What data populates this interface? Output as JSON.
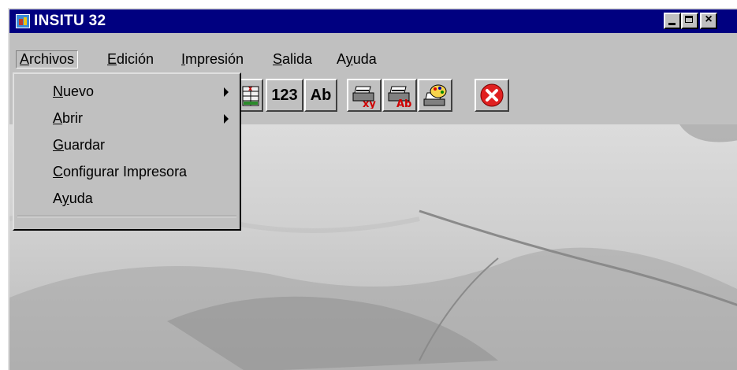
{
  "window": {
    "title": "INSITU 32"
  },
  "menubar": {
    "items": [
      {
        "label_pre": "",
        "label_u": "A",
        "label_post": "rchivos"
      },
      {
        "label_pre": "",
        "label_u": "E",
        "label_post": "dición"
      },
      {
        "label_pre": "",
        "label_u": "I",
        "label_post": "mpresión"
      },
      {
        "label_pre": "",
        "label_u": "S",
        "label_post": "alida"
      },
      {
        "label_pre": "A",
        "label_u": "y",
        "label_post": "uda"
      }
    ]
  },
  "dropdown": {
    "items": [
      {
        "label_u": "N",
        "label_post": "uevo",
        "submenu": true
      },
      {
        "label_u": "A",
        "label_post": "brir",
        "submenu": true
      },
      {
        "label_u": "G",
        "label_post": "uardar",
        "submenu": false
      },
      {
        "label_u": "C",
        "label_post": "onfigurar Impresora",
        "submenu": false
      },
      {
        "label_pre": "A",
        "label_u": "y",
        "label_post": "uda",
        "submenu": false
      }
    ]
  },
  "toolbar": {
    "buttons": [
      {
        "name": "table-icon",
        "label": ""
      },
      {
        "name": "numbers-button",
        "label": "123"
      },
      {
        "name": "text-button",
        "label": "Ab"
      },
      {
        "name": "print-xy-icon",
        "label": ""
      },
      {
        "name": "print-ab-icon",
        "label": ""
      },
      {
        "name": "print-palette-icon",
        "label": ""
      },
      {
        "name": "exit-icon",
        "label": ""
      }
    ]
  },
  "colors": {
    "titlebar": "#000080",
    "face": "#c0c0c0",
    "exit": "#e02020"
  }
}
